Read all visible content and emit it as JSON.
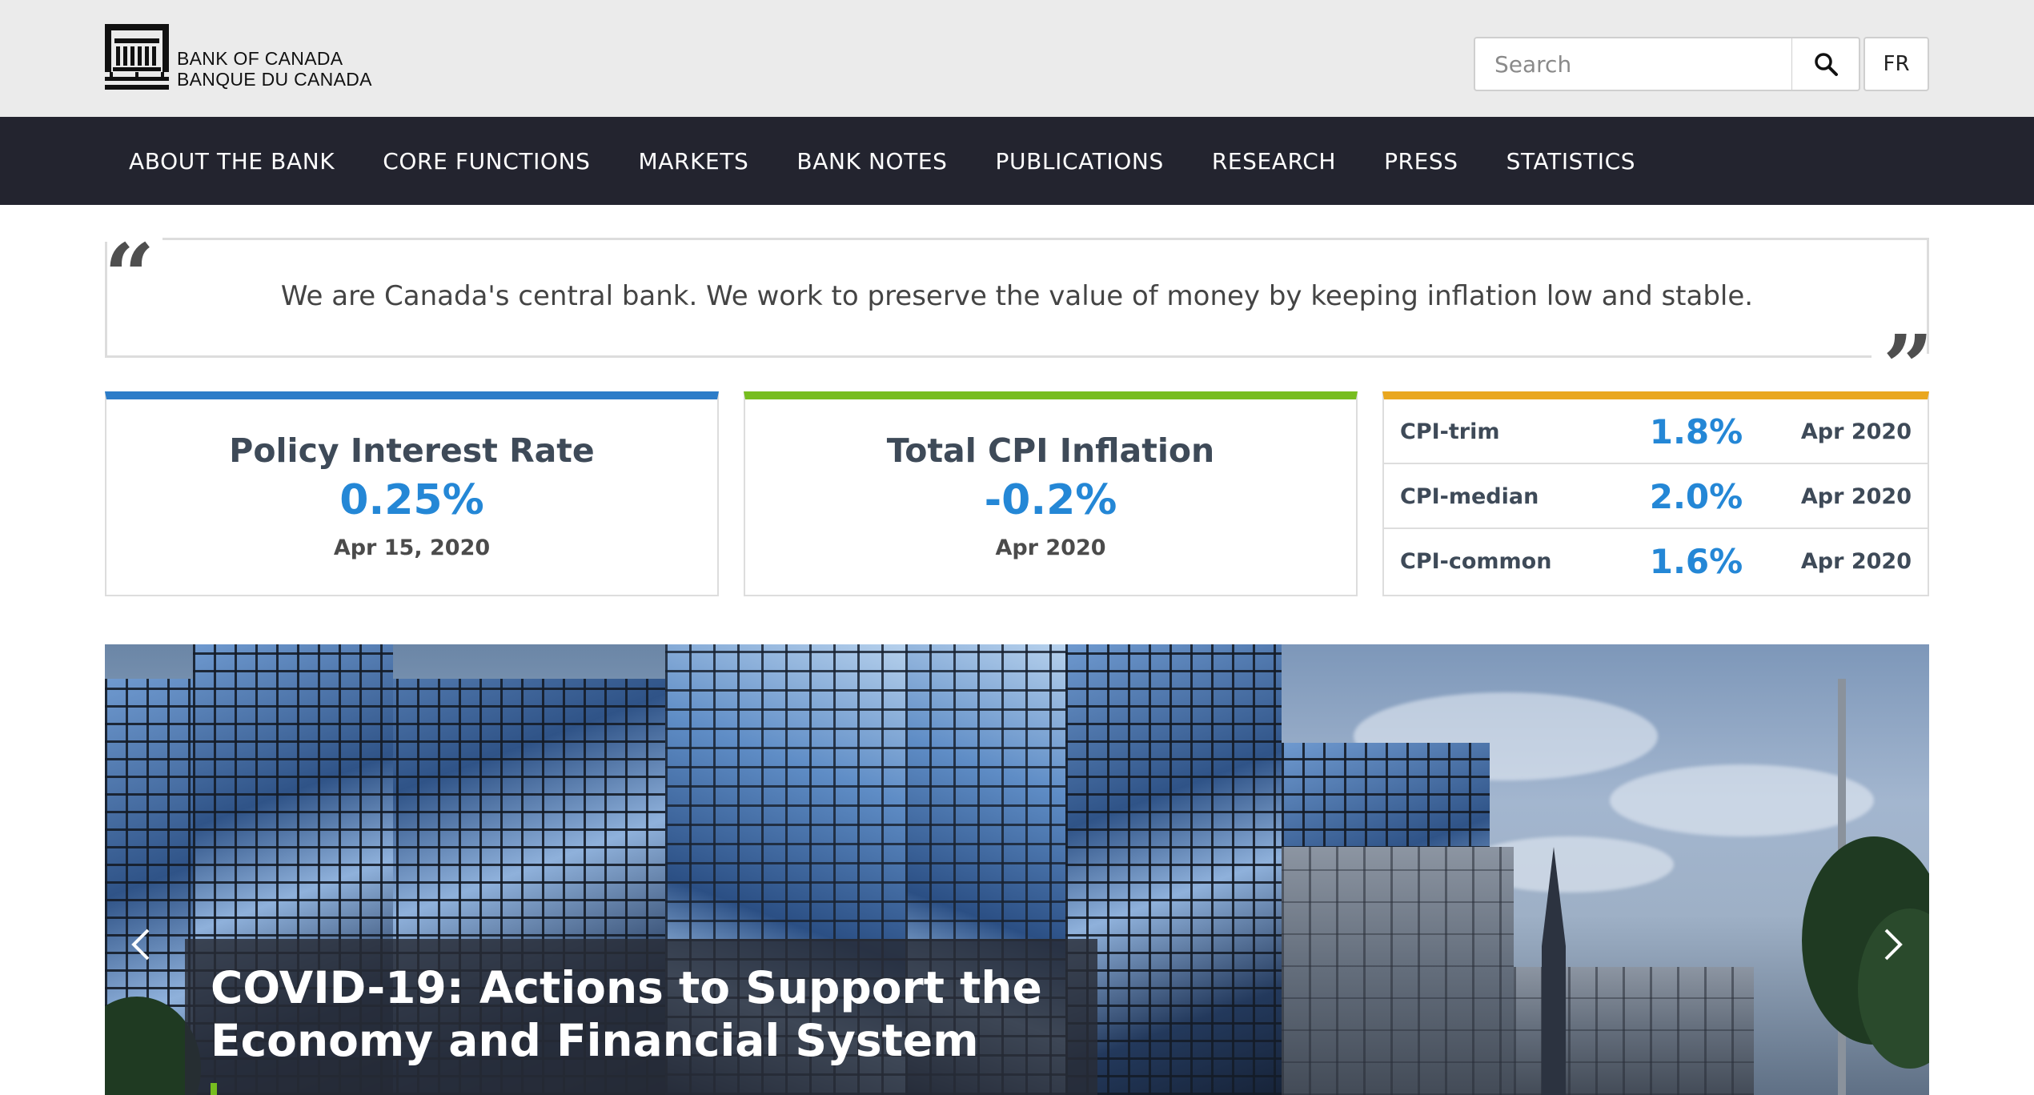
{
  "header": {
    "logo": {
      "line1": "BANK OF CANADA",
      "line2": "BANQUE DU CANADA"
    },
    "search": {
      "placeholder": "Search",
      "icon": "search-icon"
    },
    "language_button": "FR"
  },
  "nav": {
    "items": [
      "ABOUT THE BANK",
      "CORE FUNCTIONS",
      "MARKETS",
      "BANK NOTES",
      "PUBLICATIONS",
      "RESEARCH",
      "PRESS",
      "STATISTICS"
    ]
  },
  "mission": {
    "open_quote": "“",
    "close_quote": "”",
    "text": "We are Canada's central bank. We work to preserve the value of money by keeping inflation low and stable."
  },
  "stats": {
    "policy_rate": {
      "title": "Policy Interest Rate",
      "value": "0.25%",
      "date": "Apr 15, 2020"
    },
    "total_cpi": {
      "title": "Total CPI Inflation",
      "value": "-0.2%",
      "date": "Apr 2020"
    },
    "core_cpi": [
      {
        "name": "CPI-trim",
        "value": "1.8%",
        "date": "Apr 2020"
      },
      {
        "name": "CPI-median",
        "value": "2.0%",
        "date": "Apr 2020"
      },
      {
        "name": "CPI-common",
        "value": "1.6%",
        "date": "Apr 2020"
      }
    ]
  },
  "colors": {
    "nav_bg": "#23242f",
    "header_bg": "#ebebeb",
    "accent_blue": "#2c7cc8",
    "accent_green": "#77bd1f",
    "accent_gold": "#e9a71f",
    "value_blue": "#2487d6"
  },
  "hero": {
    "title": "COVID-19: Actions to Support the Economy and Financial System",
    "prev_icon": "chevron-left-icon",
    "next_icon": "chevron-right-icon"
  }
}
